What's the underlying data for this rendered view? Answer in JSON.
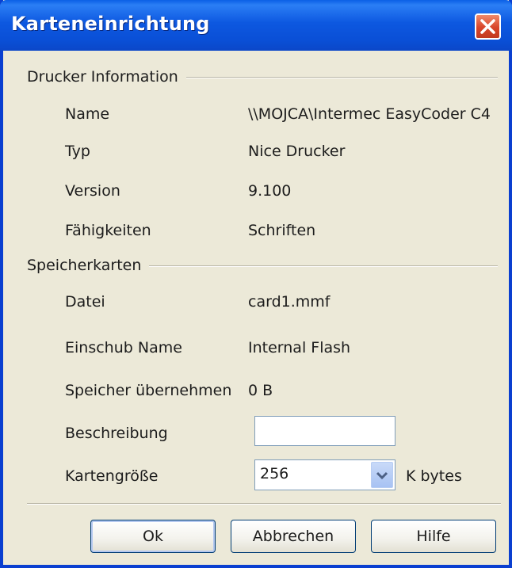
{
  "window": {
    "title": "Karteneinrichtung",
    "close_icon": "close-icon"
  },
  "printer_group": {
    "title": "Drucker Information",
    "rows": [
      {
        "label": "Name",
        "value": "\\\\MOJCA\\Intermec EasyCoder C4"
      },
      {
        "label": "Typ",
        "value": "Nice Drucker"
      },
      {
        "label": "Version",
        "value": "9.100"
      },
      {
        "label": "Fähigkeiten",
        "value": "Schriften"
      }
    ]
  },
  "card_group": {
    "title": "Speicherkarten",
    "rows": [
      {
        "label": "Datei",
        "value": "card1.mmf"
      },
      {
        "label": "Einschub Name",
        "value": "Internal Flash"
      },
      {
        "label": "Speicher übernehmen",
        "value": "0 B"
      }
    ],
    "description": {
      "label": "Beschreibung",
      "value": ""
    },
    "card_size": {
      "label": "Kartengröße",
      "value": "256",
      "unit": "K bytes"
    }
  },
  "buttons": {
    "ok": "Ok",
    "cancel": "Abbrechen",
    "help": "Hilfe"
  },
  "colors": {
    "title_bar": "#0a4fd6",
    "dialog_bg": "#ece9d8",
    "close_button": "#d8452a"
  }
}
